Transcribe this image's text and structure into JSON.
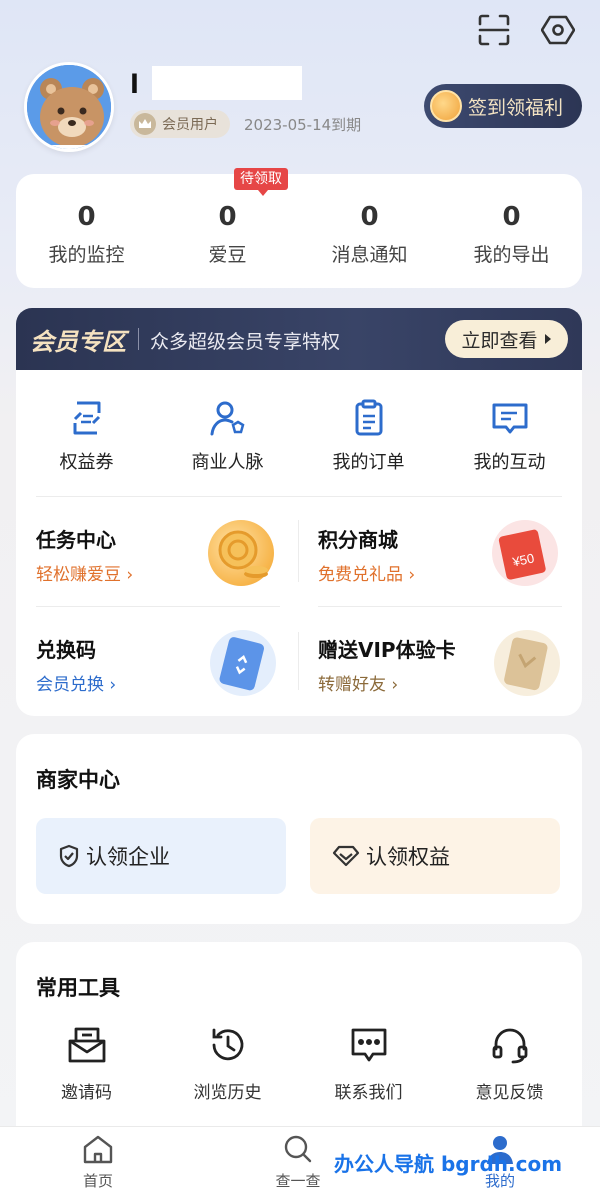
{
  "header": {
    "scan_icon": "scan-icon",
    "settings_icon": "settings-hexagon-icon"
  },
  "profile": {
    "username": "l",
    "member_label": "会员用户",
    "expire": "2023-05-14到期",
    "signin_label": "签到领福利"
  },
  "stats": {
    "pending_badge": "待领取",
    "items": [
      {
        "value": "0",
        "label": "我的监控"
      },
      {
        "value": "0",
        "label": "爱豆"
      },
      {
        "value": "0",
        "label": "消息通知"
      },
      {
        "value": "0",
        "label": "我的导出"
      }
    ]
  },
  "member_zone": {
    "title": "会员专区",
    "subtitle": "众多超级会员专享特权",
    "view_button": "立即查看",
    "quick_items": [
      {
        "label": "权益券",
        "icon": "coupon-icon"
      },
      {
        "label": "商业人脉",
        "icon": "contacts-icon"
      },
      {
        "label": "我的订单",
        "icon": "order-icon"
      },
      {
        "label": "我的互动",
        "icon": "chat-icon"
      }
    ],
    "tasks": [
      {
        "title": "任务中心",
        "sub": "轻松赚爱豆",
        "sub_color": "#e0712c"
      },
      {
        "title": "积分商城",
        "sub": "免费兑礼品",
        "sub_color": "#e0712c"
      },
      {
        "title": "兑换码",
        "sub": "会员兑换",
        "sub_color": "#2d6ccc"
      },
      {
        "title": "赠送VIP体验卡",
        "sub": "转赠好友",
        "sub_color": "#8b6a3a"
      }
    ],
    "gift_card_value": "¥50"
  },
  "merchant": {
    "title": "商家中心",
    "claim_company": "认领企业",
    "claim_rights": "认领权益"
  },
  "tools": {
    "title": "常用工具",
    "items": [
      {
        "label": "邀请码",
        "icon": "invite-icon"
      },
      {
        "label": "浏览历史",
        "icon": "history-icon"
      },
      {
        "label": "联系我们",
        "icon": "message-icon"
      },
      {
        "label": "意见反馈",
        "icon": "headset-icon"
      }
    ]
  },
  "nav": {
    "home": "首页",
    "search": "查一查",
    "mine": "我的"
  },
  "watermark": "办公人导航  bgrdh.com",
  "colors": {
    "accent": "#2d6ccc",
    "dark": "#2b3452",
    "orange": "#e0712c",
    "red_badge": "#e64646"
  }
}
